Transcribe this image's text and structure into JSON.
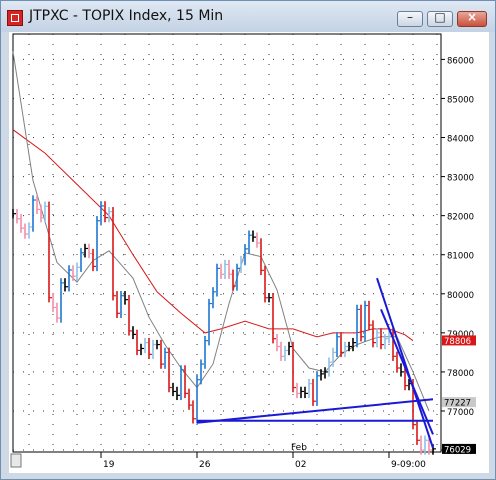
{
  "window": {
    "title": "JTPXC - TOPIX Index, 15 Min",
    "buttons": {
      "minimize": "–",
      "maximize": "□",
      "close": "×"
    }
  },
  "chart_data": {
    "type": "bar",
    "style": "ohlc-colored",
    "title": "JTPXC - TOPIX Index, 15 Min",
    "ylim": [
      759.5,
      866.5
    ],
    "y_ticks": [
      860,
      850,
      840,
      830,
      820,
      810,
      800,
      790,
      780,
      770,
      760
    ],
    "y_tick_labels": [
      "86000",
      "85000",
      "84000",
      "83000",
      "82000",
      "81000",
      "80000",
      "79000",
      "78000",
      "77000",
      "76000"
    ],
    "xlim": [
      0,
      107
    ],
    "x_ticks": [
      {
        "x": 22,
        "label": "19"
      },
      {
        "x": 46,
        "label": "26"
      },
      {
        "x": 70,
        "label": "02"
      },
      {
        "x": 94,
        "label": "9-09:00"
      }
    ],
    "x_month_label": {
      "x": 70,
      "text": "Feb"
    },
    "grid": true,
    "colors": {
      "up": "#1f77d0",
      "down": "#d81818",
      "neutral": "#000000",
      "light_up": "#8fbfe8",
      "light_down": "#f08fa8",
      "ma_long": "#d81818",
      "ma_short": "#808080",
      "trendline": "#1a1ad6"
    },
    "price_labels": [
      {
        "value": 788.06,
        "label": "78806",
        "background": "#d81818",
        "color": "#ffffff"
      },
      {
        "value": 772.27,
        "label": "77227",
        "background": "#c9c9c9",
        "color": "#000000"
      },
      {
        "value": 760.29,
        "label": "76029",
        "background": "#000000",
        "color": "#ffffff"
      }
    ],
    "series": [
      {
        "name": "",
        "role": "close",
        "x": [
          0,
          1,
          2,
          3,
          4,
          5,
          6,
          7,
          8,
          9,
          10,
          11,
          12,
          13,
          14,
          15,
          16,
          17,
          18,
          19,
          20,
          21,
          22,
          23,
          24,
          25,
          26,
          27,
          28,
          29,
          30,
          31,
          32,
          33,
          34,
          35,
          36,
          37,
          38,
          39,
          40,
          41,
          42,
          43,
          44,
          45,
          46,
          47,
          48,
          49,
          50,
          51,
          52,
          53,
          54,
          55,
          56,
          57,
          58,
          59,
          60,
          61,
          62,
          63,
          64,
          65,
          66,
          67,
          68,
          69,
          70,
          71,
          72,
          73,
          74,
          75,
          76,
          77,
          78,
          79,
          80,
          81,
          82,
          83,
          84,
          85,
          86,
          87,
          88,
          89,
          90,
          91,
          92,
          93,
          94,
          95,
          96,
          97,
          98,
          99,
          100,
          101,
          102,
          103,
          104,
          105
        ],
        "values": [
          820.5,
          819.2,
          816.8,
          815.3,
          817.1,
          824.0,
          821.6,
          819.5,
          822.4,
          799.0,
          796.5,
          793.8,
          802.8,
          801.8,
          806.1,
          804.5,
          806.8,
          810.5,
          811.6,
          810.3,
          807.0,
          818.7,
          822.5,
          819.5,
          821.0,
          799.5,
          795.0,
          799.5,
          798.5,
          790.5,
          789.6,
          785.5,
          786.0,
          787.5,
          784.5,
          787.0,
          787.0,
          782.0,
          785.0,
          776.0,
          775.0,
          774.0,
          780.5,
          774.5,
          771.5,
          768.0,
          778.0,
          782.0,
          788.0,
          797.5,
          800.5,
          806.5,
          805.0,
          807.5,
          805.0,
          802.0,
          806.5,
          808.5,
          811.5,
          815.0,
          814.5,
          813.0,
          806.0,
          799.0,
          799.0,
          788.5,
          786.5,
          784.0,
          785.5,
          786.5,
          776.0,
          774.5,
          775.0,
          774.5,
          777.0,
          772.5,
          779.0,
          779.5,
          780.0,
          782.5,
          785.0,
          789.0,
          785.0,
          786.5,
          786.5,
          787.5,
          796.0,
          789.0,
          797.0,
          792.0,
          787.5,
          790.0,
          787.0,
          788.5,
          790.0,
          784.0,
          781.0,
          780.0,
          776.5,
          777.0,
          766.5,
          762.5,
          760.0,
          762.5,
          760.0,
          760.3
        ]
      },
      {
        "name": "",
        "role": "long-moving-average",
        "x": [
          0,
          8,
          16,
          24,
          30,
          36,
          42,
          48,
          52,
          58,
          64,
          70,
          76,
          80,
          86,
          90,
          94,
          98,
          100
        ],
        "values": [
          842.0,
          836.0,
          828.0,
          820.0,
          810.0,
          800.5,
          795.0,
          790.0,
          791.0,
          793.0,
          791.0,
          791.0,
          789.0,
          790.0,
          790.0,
          791.0,
          791.0,
          789.5,
          788.0
        ]
      },
      {
        "name": "",
        "role": "short-moving-average",
        "x": [
          0,
          5,
          11,
          16,
          20,
          24,
          30,
          34,
          38,
          42,
          46,
          50,
          54,
          58,
          62,
          66,
          70,
          74,
          78,
          82,
          86,
          90,
          92,
          96,
          100,
          104
        ],
        "values": [
          862.0,
          829.0,
          808.0,
          803.0,
          808.5,
          811.0,
          804.0,
          794.0,
          787.0,
          781.0,
          776.0,
          782.0,
          797.5,
          810.5,
          809.5,
          801.0,
          786.0,
          781.0,
          780.0,
          784.5,
          787.0,
          788.5,
          789.0,
          789.0,
          780.0,
          770.0
        ]
      }
    ],
    "trendlines": [
      {
        "x": [
          46,
          105
        ],
        "y": [
          767.0,
          773.0
        ]
      },
      {
        "x": [
          46,
          105
        ],
        "y": [
          767.5,
          767.5
        ]
      },
      {
        "x": [
          91,
          105
        ],
        "y": [
          804.0,
          760.5
        ]
      },
      {
        "x": [
          92,
          105
        ],
        "y": [
          796.0,
          764.0
        ]
      }
    ]
  }
}
